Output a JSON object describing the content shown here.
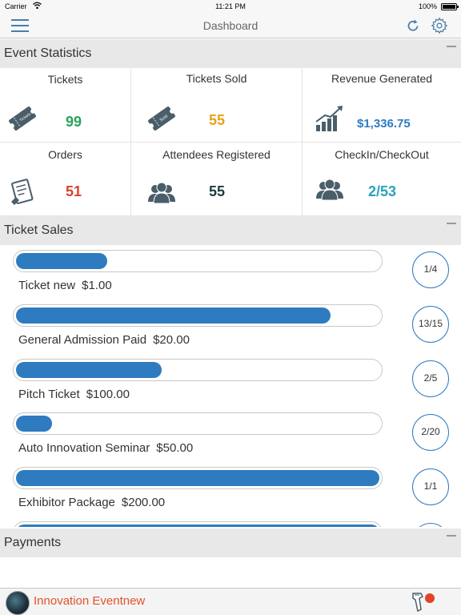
{
  "status_bar": {
    "carrier": "Carrier",
    "time": "11:21 PM",
    "battery": "100%"
  },
  "navbar": {
    "title": "Dashboard",
    "menu_icon": "hamburger-menu-icon",
    "refresh_icon": "refresh-icon",
    "settings_icon": "gear-icon"
  },
  "event_statistics": {
    "header": "Event Statistics",
    "cells": [
      {
        "caption": "Tickets",
        "value": "99",
        "color": "#2aa35a",
        "icon": "ticket-icon"
      },
      {
        "caption": "Tickets Sold",
        "value": "55",
        "color": "#e8a317",
        "icon": "sold-ticket-icon"
      },
      {
        "caption": "Revenue Generated",
        "value": "$1,336.75",
        "color": "#2e7bc0",
        "icon": "revenue-chart-icon"
      },
      {
        "caption": "Orders",
        "value": "51",
        "color": "#d8432a",
        "icon": "order-icon"
      },
      {
        "caption": "Attendees Registered",
        "value": "55",
        "color": "#1f3d3d",
        "icon": "attendees-icon"
      },
      {
        "caption": "CheckIn/CheckOut",
        "value": "2/53",
        "color": "#2aa3b8",
        "icon": "checkin-icon"
      }
    ]
  },
  "ticket_sales": {
    "header": "Ticket Sales",
    "items": [
      {
        "name": "Ticket new",
        "price": "$1.00",
        "sold": 1,
        "total": 4,
        "counter": "1/4"
      },
      {
        "name": "General Admission Paid",
        "price": "$20.00",
        "sold": 13,
        "total": 15,
        "counter": "13/15"
      },
      {
        "name": "Pitch Ticket",
        "price": "$100.00",
        "sold": 2,
        "total": 5,
        "counter": "2/5"
      },
      {
        "name": "Auto Innovation Seminar",
        "price": "$50.00",
        "sold": 2,
        "total": 20,
        "counter": "2/20"
      },
      {
        "name": "Exhibitor Package",
        "price": "$200.00",
        "sold": 1,
        "total": 1,
        "counter": "1/1"
      }
    ]
  },
  "payments": {
    "header": "Payments"
  },
  "footer": {
    "event_name": "Innovation Eventnew",
    "scanner_icon": "barcode-scanner-icon"
  },
  "colors": {
    "accent": "#2e7bc0",
    "brand": "#e0532a"
  }
}
